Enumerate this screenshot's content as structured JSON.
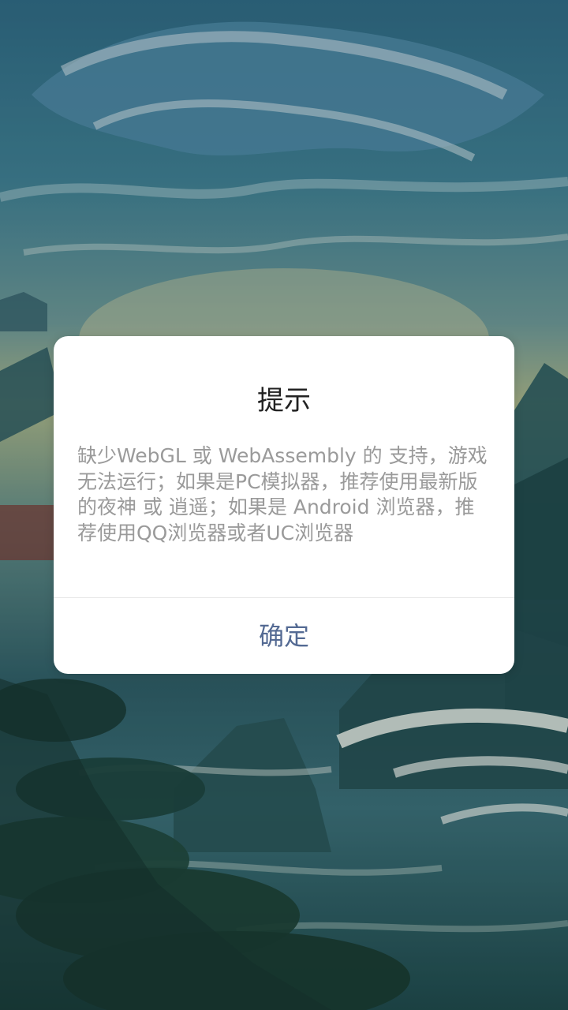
{
  "dialog": {
    "title": "提示",
    "message": "缺少WebGL 或 WebAssembly 的 支持，游戏无法运行；如果是PC模拟器，推荐使用最新版的夜神 或 逍遥；如果是 Android 浏览器，推荐使用QQ浏览器或者UC浏览器",
    "confirm_label": "确定"
  },
  "colors": {
    "accent": "#546a93",
    "title": "#222222",
    "message": "#9a9a9a"
  }
}
